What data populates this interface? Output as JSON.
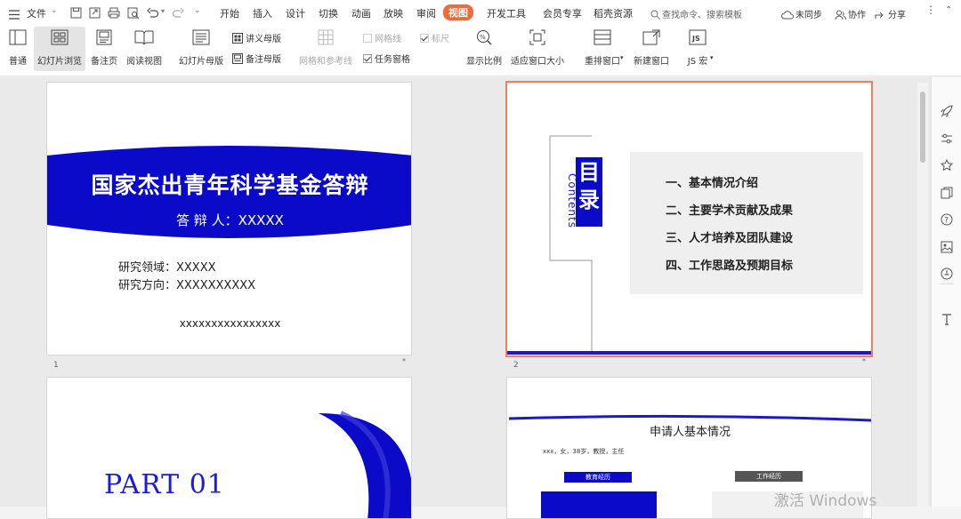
{
  "topbar": {
    "file_menu": "文件",
    "tabs": [
      "开始",
      "插入",
      "设计",
      "切换",
      "动画",
      "放映",
      "审阅",
      "视图",
      "开发工具",
      "会员专享",
      "稻壳资源"
    ],
    "active_tab": "视图",
    "search_placeholder": "查找命令、搜索模板",
    "sync_label": "未同步",
    "collab_label": "协作",
    "share_label": "分享"
  },
  "ribbon": {
    "normal": "普通",
    "slide_browse": "幻灯片浏览",
    "notes_page": "备注页",
    "reading_view": "阅读视图",
    "slide_master": "幻灯片母版",
    "handout_master": "讲义母版",
    "notes_master": "备注母版",
    "grid_guides": "网格和参考线",
    "gridlines": "网格线",
    "ruler": "标尺",
    "task_pane": "任务窗格",
    "zoom": "显示比例",
    "fit_window": "适应窗口大小",
    "arrange_window": "重排窗口",
    "new_window": "新建窗口",
    "js_macro": "JS 宏"
  },
  "slides": {
    "s1": {
      "number": "1",
      "title": "国家杰出青年科学基金答辩",
      "presenter": "答 辩 人：XXXXX",
      "field": "研究领域：XXXXX",
      "direction": "研究方向：XXXXXXXXXX",
      "footer": "xxxxxxxxxxxxxxxx"
    },
    "s2": {
      "number": "2",
      "toc_title": "目录",
      "toc_en": "Contents",
      "items": [
        "一、基本情况介绍",
        "二、主要学术贡献及成果",
        "三、人才培养及团队建设",
        "四、工作思路及预期目标"
      ]
    },
    "s3": {
      "part_label": "PART 01"
    },
    "s4": {
      "title": "申请人基本情况",
      "info": "xxx，女，38岁，教授，主任",
      "edu_label": "教育经历",
      "work_label": "工作经历"
    }
  },
  "watermark": "激活 Windows",
  "colors": {
    "accent": "#f06a3c",
    "slide_blue": "#0a0ac8",
    "selection": "#f07f5a"
  }
}
